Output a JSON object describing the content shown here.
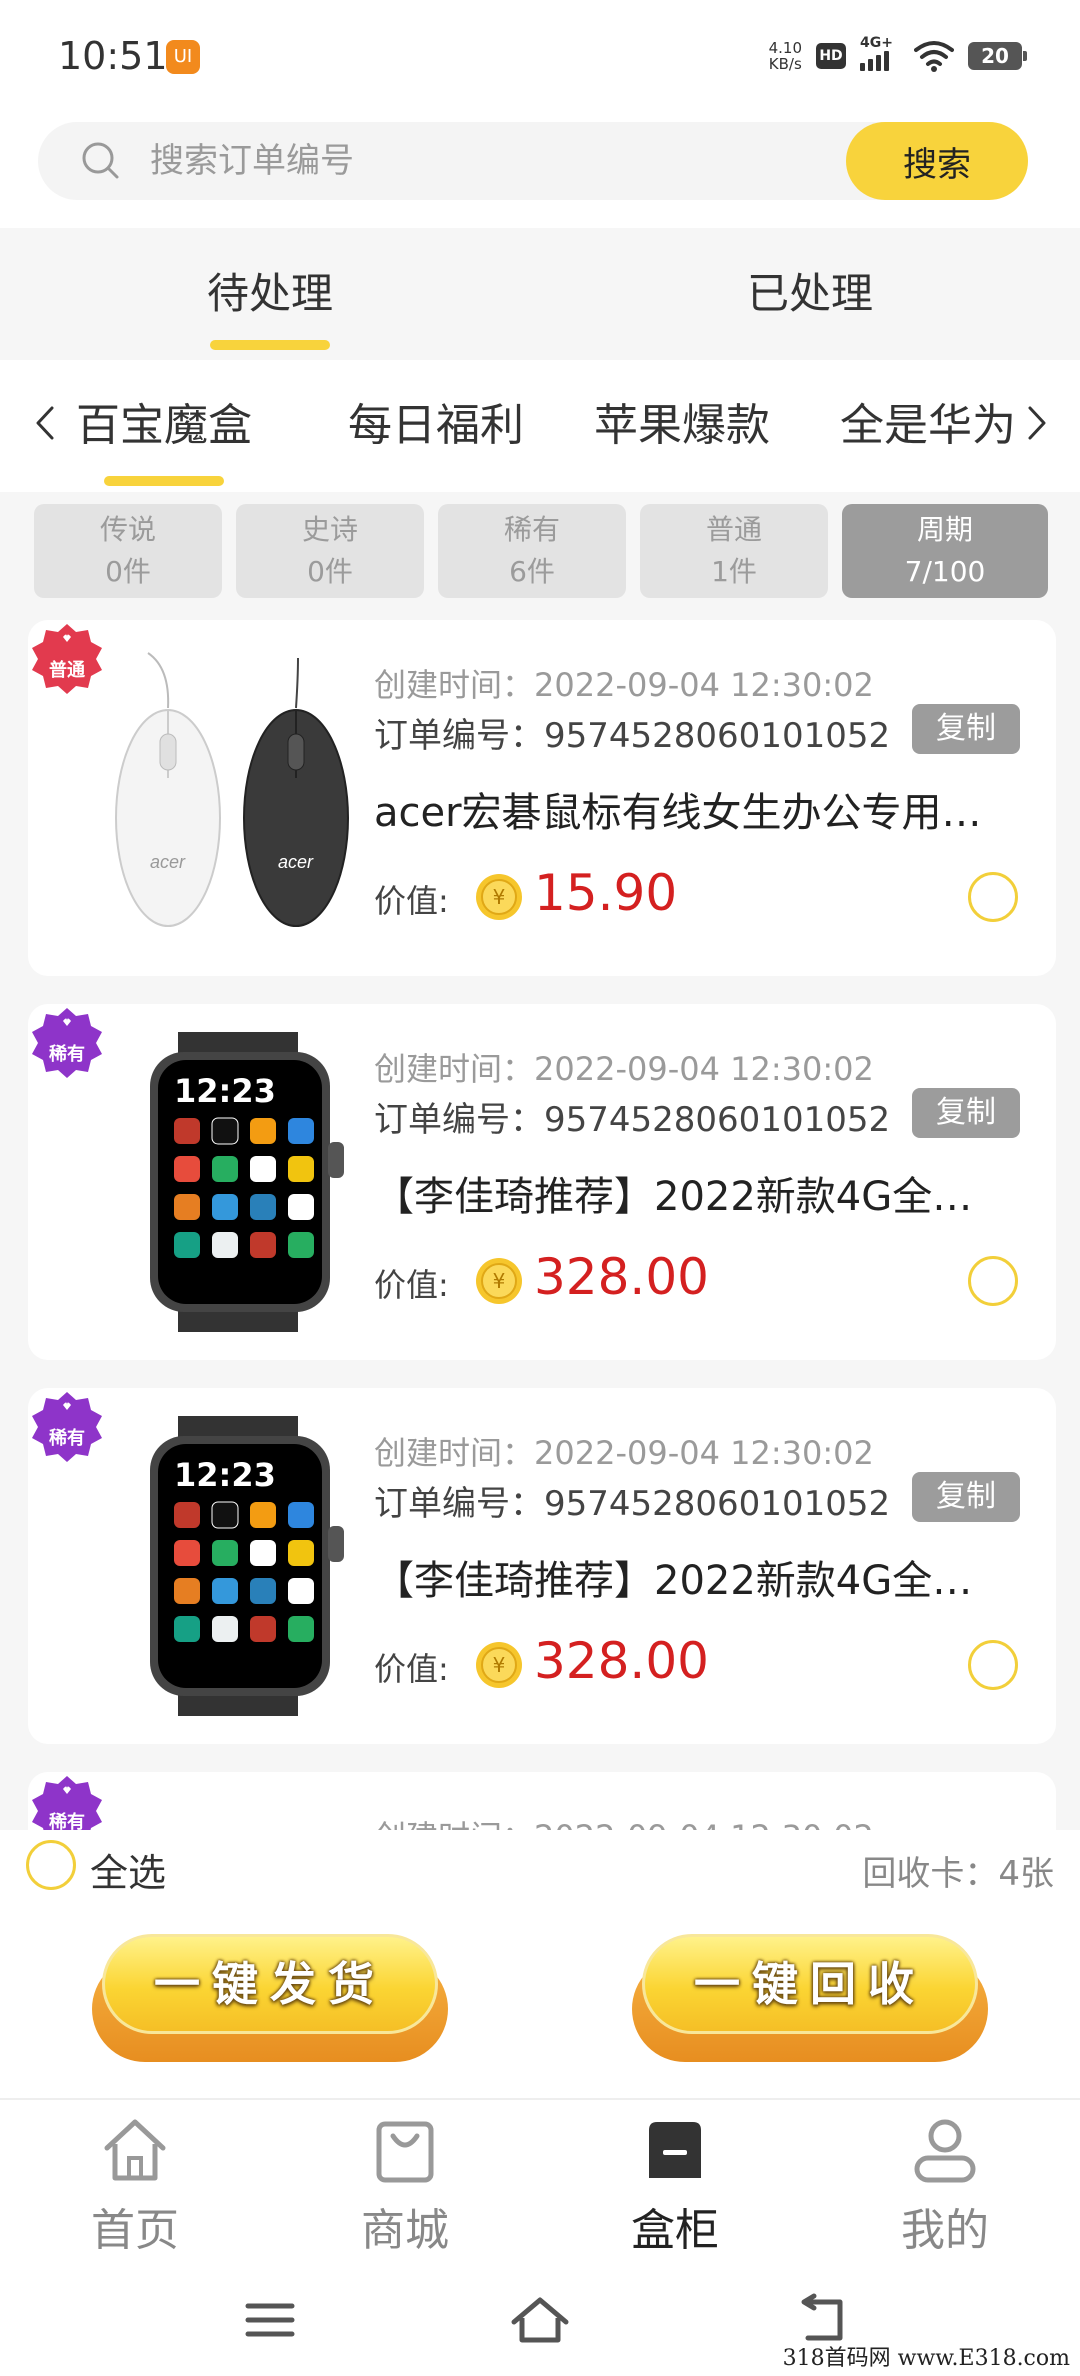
{
  "status_bar": {
    "time": "10:51",
    "app_icon_text": "UI",
    "net_speed_value": "4.10",
    "net_speed_unit": "KB/s",
    "hd_label": "HD",
    "signal_label": "4G+",
    "battery_level": "20"
  },
  "search": {
    "placeholder": "搜索订单编号",
    "button_label": "搜索"
  },
  "status_tabs": [
    {
      "label": "待处理",
      "active": true
    },
    {
      "label": "已处理",
      "active": false
    }
  ],
  "categories": [
    {
      "label": "百宝魔盒",
      "active": true
    },
    {
      "label": "每日福利",
      "active": false
    },
    {
      "label": "苹果爆款",
      "active": false
    },
    {
      "label": "全是华为",
      "active": false
    }
  ],
  "rarity_filters": [
    {
      "name": "传说",
      "count": "0件"
    },
    {
      "name": "史诗",
      "count": "0件"
    },
    {
      "name": "稀有",
      "count": "6件"
    },
    {
      "name": "普通",
      "count": "1件"
    },
    {
      "name": "周期",
      "count": "7/100",
      "selected": true
    }
  ],
  "labels": {
    "create_time_prefix": "创建时间：",
    "order_no_prefix": "订单编号：",
    "copy": "复制",
    "price_prefix": "价值:",
    "coin_symbol": "¥"
  },
  "orders": [
    {
      "badge": "普通",
      "badge_color": "#e23a4e",
      "create_time": "创建时间：2022-09-04 12:30:02",
      "order_no": "订单编号：9574528060101052",
      "title": "acer宏碁鼠标有线女生办公专用…",
      "price": "15.90",
      "product_icon": "mouse-icon"
    },
    {
      "badge": "稀有",
      "badge_color": "#8e34c9",
      "create_time": "创建时间：2022-09-04 12:30:02",
      "order_no": "订单编号：9574528060101052",
      "title": "【李佳琦推荐】2022新款4G全…",
      "price": "328.00",
      "product_icon": "smartwatch-icon"
    },
    {
      "badge": "稀有",
      "badge_color": "#8e34c9",
      "create_time": "创建时间：2022-09-04 12:30:02",
      "order_no": "订单编号：9574528060101052",
      "title": "【李佳琦推荐】2022新款4G全…",
      "price": "328.00",
      "product_icon": "smartwatch-icon"
    },
    {
      "badge": "稀有",
      "badge_color": "#8e34c9",
      "create_time": "创建时间：2022-09-04 12:30:02",
      "order_no": "",
      "title": "",
      "price": "",
      "product_icon": ""
    }
  ],
  "watch_screen": {
    "time": "12:23"
  },
  "mouse_brand": "acer",
  "footer": {
    "select_all": "全选",
    "recycle_cards": "回收卡：4张",
    "ship_all": "一键发货",
    "recycle_all": "一键回收"
  },
  "bottom_nav": [
    {
      "label": "首页",
      "icon": "home-icon",
      "active": false
    },
    {
      "label": "商城",
      "icon": "shopping-bag-icon",
      "active": false
    },
    {
      "label": "盒柜",
      "icon": "box-cabinet-icon",
      "active": true
    },
    {
      "label": "我的",
      "icon": "user-icon",
      "active": false
    }
  ],
  "watermark": "318首码网 www.E318.com",
  "colors": {
    "accent": "#f8d33c",
    "price": "#d42020",
    "common_badge": "#e23a4e",
    "rare_badge": "#8e34c9"
  }
}
